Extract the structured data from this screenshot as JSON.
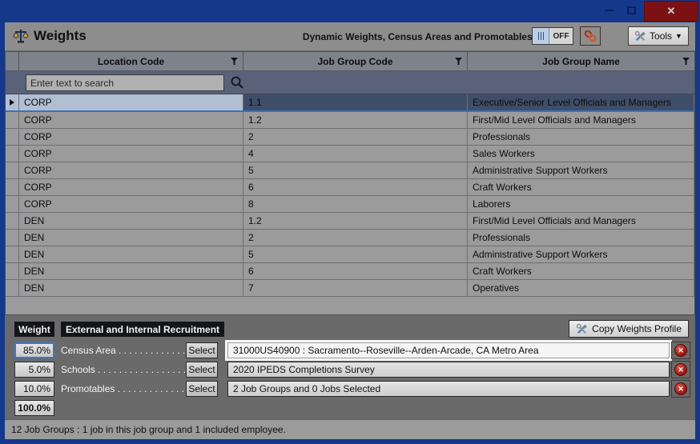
{
  "window": {
    "close_glyph": "✕"
  },
  "header": {
    "title": "Weights",
    "dynamic_label": "Dynamic Weights, Census Areas and Promotables :",
    "toggle_state": "OFF",
    "tools_label": "Tools",
    "tools_chevron": "▼"
  },
  "grid": {
    "columns": [
      "Location Code",
      "Job Group Code",
      "Job Group Name"
    ],
    "search_placeholder": "Enter text to search",
    "selected_row_index": 0,
    "rows": [
      [
        "CORP",
        "1.1",
        "Executive/Senior Level Officials and Managers"
      ],
      [
        "CORP",
        "1.2",
        "First/Mid Level Officials and Managers"
      ],
      [
        "CORP",
        "2",
        "Professionals"
      ],
      [
        "CORP",
        "4",
        "Sales Workers"
      ],
      [
        "CORP",
        "5",
        "Administrative Support Workers"
      ],
      [
        "CORP",
        "6",
        "Craft Workers"
      ],
      [
        "CORP",
        "8",
        "Laborers"
      ],
      [
        "DEN",
        "1.2",
        "First/Mid Level Officials and Managers"
      ],
      [
        "DEN",
        "2",
        "Professionals"
      ],
      [
        "DEN",
        "5",
        "Administrative Support Workers"
      ],
      [
        "DEN",
        "6",
        "Craft Workers"
      ],
      [
        "DEN",
        "7",
        "Operatives"
      ]
    ]
  },
  "weights_panel": {
    "weight_header": "Weight",
    "recruitment_header": "External and Internal Recruitment",
    "copy_button_label": "Copy Weights Profile",
    "total": "100.0%",
    "rows": [
      {
        "weight": "85.0%",
        "label": "Census Area . . . . . . . . . . . . . ....",
        "select_label": "Select",
        "value": "31000US40900 : Sacramento--Roseville--Arden-Arcade, CA Metro Area",
        "highlighted": true
      },
      {
        "weight": "5.0%",
        "label": "Schools . . . . . . . . . . . . . . . . . ....",
        "select_label": "Select",
        "value": "2020 IPEDS Completions Survey",
        "highlighted": false
      },
      {
        "weight": "10.0%",
        "label": "Promotables . . . . . . . . . . . . . ....",
        "select_label": "Select",
        "value": "2 Job Groups and 0 Jobs Selected",
        "highlighted": false
      }
    ]
  },
  "status_bar": {
    "text": "12 Job Groups : 1 job in this job group and 1 included employee."
  },
  "colors": {
    "titlebar_blue": "#15388c",
    "close_red": "#7c1113",
    "header_gray": "#8d8d8d",
    "column_header": "#7e828b",
    "search_band": "#59627a",
    "row_gray": "#9b9b9b",
    "selected_cell_light": "#b2bfd2",
    "selected_cell_dark": "#3f4e68",
    "selection_border": "#3a70bc",
    "panel_gray": "#6a6a6a",
    "black_header": "#14141b",
    "delete_red": "#9c1410"
  }
}
